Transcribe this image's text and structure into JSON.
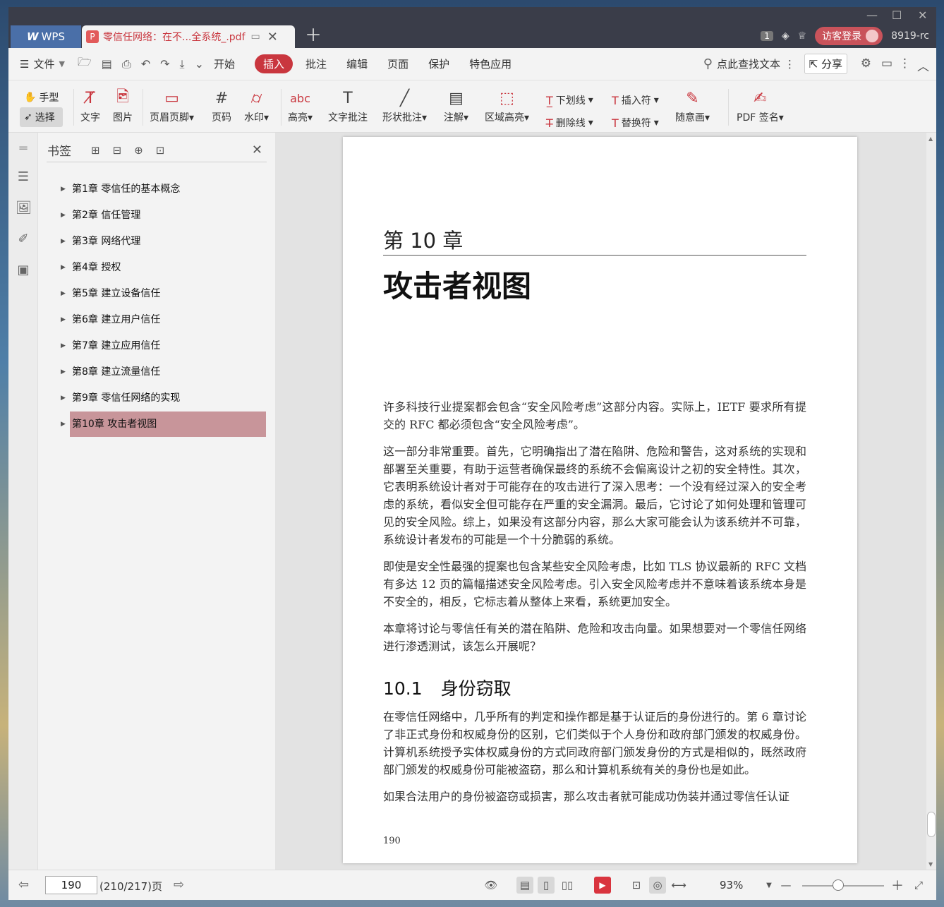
{
  "titlebar": {
    "app_tab": "WPS",
    "doc_tab": "零信任网络：在不...全系统_.pdf",
    "badge_count": "1",
    "login_label": "访客登录",
    "user_id": "8919-rc"
  },
  "menu": {
    "file": "文件",
    "items": [
      "开始",
      "插入",
      "批注",
      "编辑",
      "页面",
      "保护",
      "特色应用"
    ],
    "active": "插入",
    "search": "点此查找文本",
    "share": "分享"
  },
  "toolbar": {
    "hand": "手型",
    "select": "选择",
    "text": "文字",
    "image": "图片",
    "header_footer": "页眉页脚",
    "page_number": "页码",
    "watermark": "水印",
    "highlight": "高亮",
    "text_comment": "文字批注",
    "shape_comment": "形状批注",
    "note": "注解",
    "area_highlight": "区域高亮",
    "underline": "下划线",
    "strikethrough": "删除线",
    "insert_mark": "插入符",
    "replace_mark": "替换符",
    "freehand": "随意画",
    "pdf_sign": "PDF 签名"
  },
  "bookmarks": {
    "title": "书签",
    "items": [
      "第1章  零信任的基本概念",
      "第2章  信任管理",
      "第3章  网络代理",
      "第4章  授权",
      "第5章  建立设备信任",
      "第6章  建立用户信任",
      "第7章  建立应用信任",
      "第8章  建立流量信任",
      "第9章  零信任网络的实现",
      "第10章  攻击者视图"
    ],
    "selected_index": 9
  },
  "page": {
    "chapter_number": "第 10 章",
    "chapter_title": "攻击者视图",
    "p1": "许多科技行业提案都会包含“安全风险考虑”这部分内容。实际上，IETF 要求所有提交的 RFC 都必须包含“安全风险考虑”。",
    "p2": "这一部分非常重要。首先，它明确指出了潜在陷阱、危险和警告，这对系统的实现和部署至关重要，有助于运营者确保最终的系统不会偏离设计之初的安全特性。其次，它表明系统设计者对于可能存在的攻击进行了深入思考：一个没有经过深入的安全考虑的系统，看似安全但可能存在严重的安全漏洞。最后，它讨论了如何处理和管理可见的安全风险。综上，如果没有这部分内容，那么大家可能会认为该系统并不可靠，系统设计者发布的可能是一个十分脆弱的系统。",
    "p3": "即使是安全性最强的提案也包含某些安全风险考虑，比如 TLS 协议最新的 RFC 文档有多达 12 页的篇幅描述安全风险考虑。引入安全风险考虑并不意味着该系统本身是不安全的，相反，它标志着从整体上来看，系统更加安全。",
    "p4": "本章将讨论与零信任有关的潜在陷阱、危险和攻击向量。如果想要对一个零信任网络进行渗透测试，该怎么开展呢？",
    "section_number": "10.1",
    "section_title": "身份窃取",
    "p5": "在零信任网络中，几乎所有的判定和操作都是基于认证后的身份进行的。第 6 章讨论了非正式身份和权威身份的区别，它们类似于个人身份和政府部门颁发的权威身份。计算机系统授予实体权威身份的方式同政府部门颁发身份的方式是相似的，既然政府部门颁发的权威身份可能被盗窃，那么和计算机系统有关的身份也是如此。",
    "p6": "如果合法用户的身份被盗窃或损害，那么攻击者就可能成功伪装并通过零信任认证",
    "page_number": "190"
  },
  "status": {
    "current_page": "190",
    "page_count": "(210/217)页",
    "zoom": "93%"
  },
  "colors": {
    "accent": "#c9363e",
    "bookmark_selected": "#c8959a",
    "titlebar": "#3a3d49"
  }
}
